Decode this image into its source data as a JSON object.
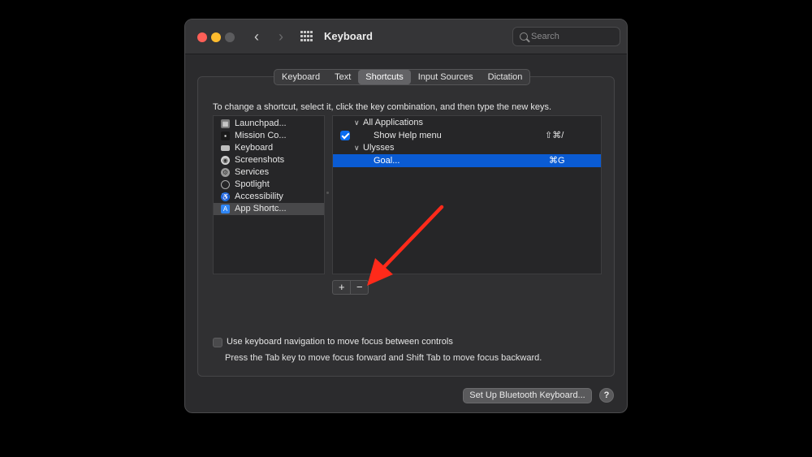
{
  "window": {
    "title": "Keyboard",
    "search_placeholder": "Search"
  },
  "tabs": [
    {
      "label": "Keyboard",
      "active": false
    },
    {
      "label": "Text",
      "active": false
    },
    {
      "label": "Shortcuts",
      "active": true
    },
    {
      "label": "Input Sources",
      "active": false
    },
    {
      "label": "Dictation",
      "active": false
    }
  ],
  "instructions": "To change a shortcut, select it, click the key combination, and then type the new keys.",
  "categories": [
    {
      "label": "Launchpad...",
      "icon": "launchpad-icon",
      "selected": false
    },
    {
      "label": "Mission Co...",
      "icon": "mission-control-icon",
      "selected": false
    },
    {
      "label": "Keyboard",
      "icon": "keyboard-icon",
      "selected": false
    },
    {
      "label": "Screenshots",
      "icon": "screenshots-icon",
      "selected": false
    },
    {
      "label": "Services",
      "icon": "services-gear-icon",
      "selected": false
    },
    {
      "label": "Spotlight",
      "icon": "spotlight-icon",
      "selected": false
    },
    {
      "label": "Accessibility",
      "icon": "accessibility-icon",
      "selected": false
    },
    {
      "label": "App Shortc...",
      "icon": "app-shortcuts-icon",
      "selected": true
    }
  ],
  "shortcuts": {
    "group1": {
      "label": "All Applications"
    },
    "item1": {
      "label": "Show Help menu",
      "keys": "⇧⌘/",
      "checked": true
    },
    "group2": {
      "label": "Ulysses"
    },
    "item2": {
      "label": "Goal...",
      "keys": "⌘G",
      "selected": true
    }
  },
  "buttons": {
    "add": "+",
    "remove": "−",
    "bluetooth": "Set Up Bluetooth Keyboard...",
    "help": "?"
  },
  "keyboard_nav": {
    "label": "Use keyboard navigation to move focus between controls",
    "help": "Press the Tab key to move focus forward and Shift Tab to move focus backward.",
    "checked": false
  },
  "colors": {
    "accent_blue": "#0a5bd3",
    "annotation_red": "#ff2a1a"
  }
}
